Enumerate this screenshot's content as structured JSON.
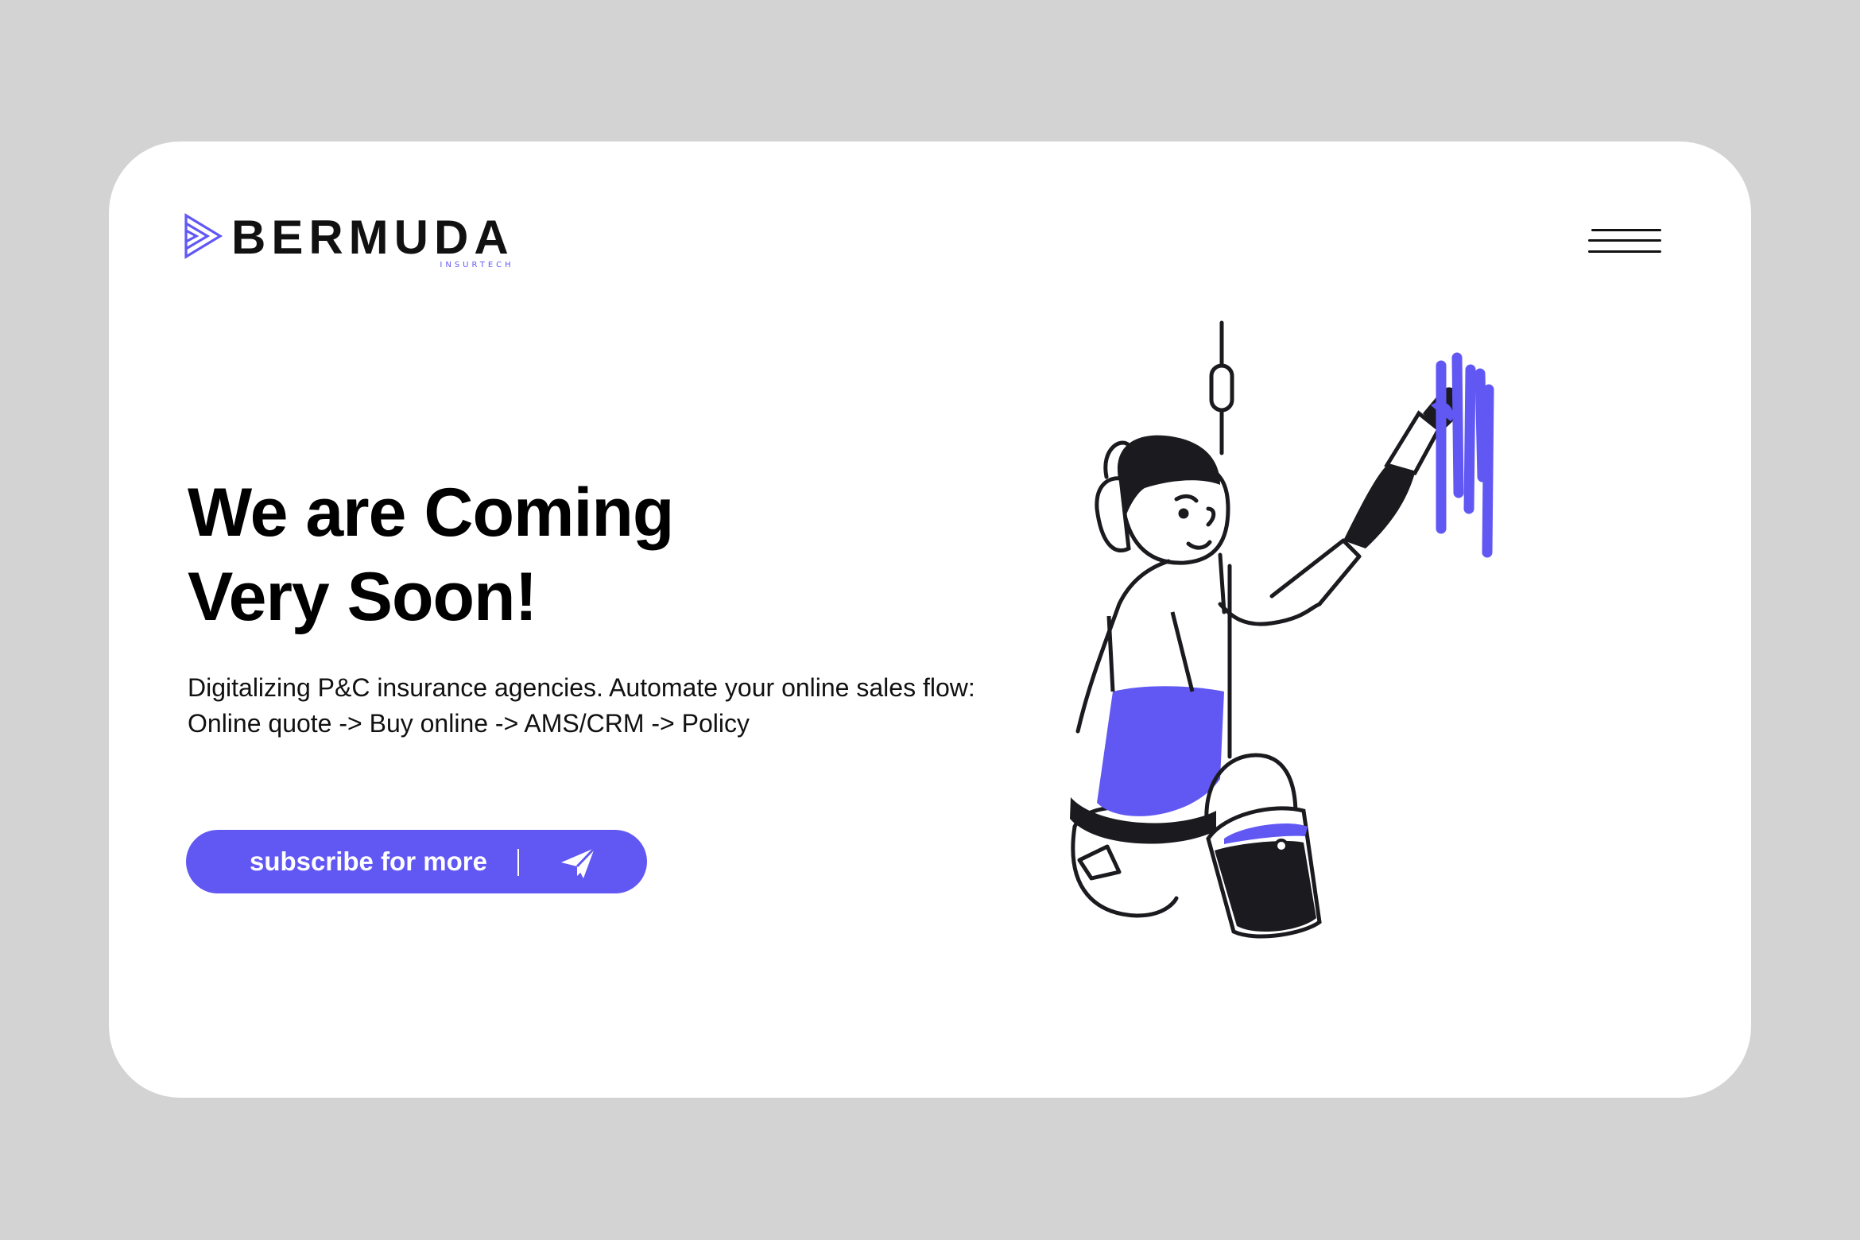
{
  "brand": {
    "name": "BERMUDA",
    "tagline": "INSURTECH",
    "logo_icon": "triple-chevron-play-logo"
  },
  "nav": {
    "menu_icon": "hamburger-menu-icon"
  },
  "hero": {
    "headline_line1": "We are Coming",
    "headline_line2": "Very Soon!",
    "description_line1": "Digitalizing P&C insurance agencies. Automate your online sales flow:",
    "description_line2": "Online quote -> Buy online -> AMS/CRM -> Policy"
  },
  "cta": {
    "label": "subscribe for more",
    "icon": "paper-plane-send-icon"
  },
  "illustration": {
    "subject": "painter-on-rope-icon"
  },
  "colors": {
    "accent": "#6158f4",
    "background": "#d3d3d3",
    "card": "#ffffff",
    "text": "#111111"
  }
}
